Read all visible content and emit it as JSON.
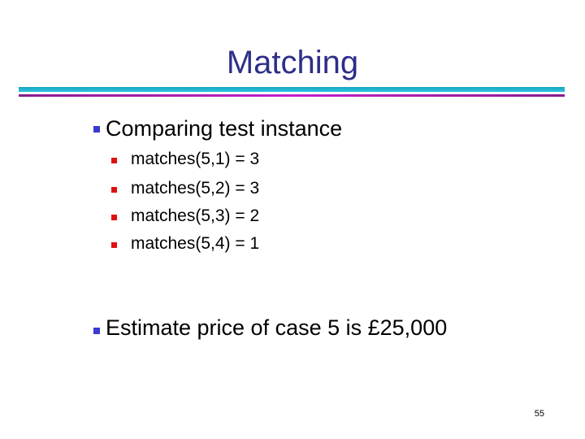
{
  "slide": {
    "title": "Matching",
    "bullets": [
      {
        "text": "Comparing test instance",
        "sub_bullets": [
          "matches(5,1) = 3",
          "matches(5,2) = 3",
          "matches(5,3) = 2",
          "matches(5,4) = 1"
        ]
      },
      {
        "text": "Estimate price of case 5 is £25,000"
      }
    ],
    "page_number": "55"
  },
  "colors": {
    "title": "#2e2e8a",
    "rule_top": "#2cc4e0",
    "rule_bottom": "#c21fc8",
    "bullet_level1": "#3a3ad0",
    "bullet_level2": "#e01010"
  }
}
